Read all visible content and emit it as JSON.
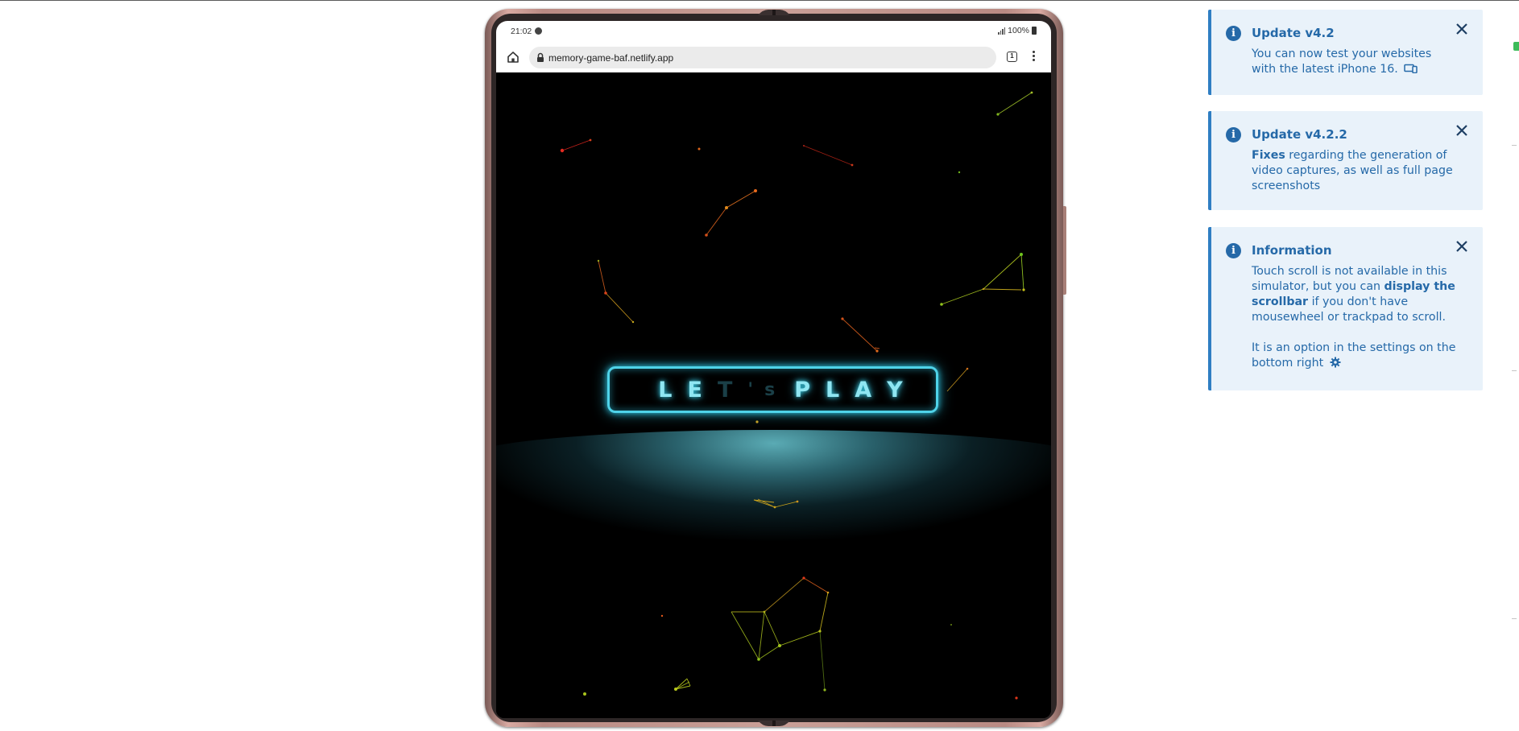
{
  "phone": {
    "status_time": "21:02",
    "battery": "100%",
    "url": "memory-game-baf.netlify.app",
    "tab_count": "1"
  },
  "game": {
    "play_letters": [
      "L",
      "E",
      "T",
      "'s",
      "P",
      "L",
      "A",
      "Y"
    ],
    "play_label": "LET's PLAY",
    "glow_color": "#4fd3e9"
  },
  "notifications": [
    {
      "title": "Update v4.2",
      "body_lines": [
        "You can now test your websites",
        "with the latest iPhone 16."
      ]
    },
    {
      "title": "Update v4.2.2",
      "body_bold": "Fixes",
      "body_rest": " regarding the generation of video captures, as well as full page screenshots"
    },
    {
      "title": "Information",
      "body_p1_a": "Touch scroll is not available in this simulator, but you can ",
      "body_p1_bold": "display the scrollbar",
      "body_p1_c": " if you don't have mousewheel or trackpad to scroll.",
      "body_p2": "It is an option in the settings on the bottom right"
    }
  ],
  "colors": {
    "accent": "#2f7ec3",
    "notif_bg": "#e9f2fa",
    "notif_text": "#2569a8"
  },
  "icons": [
    "home-icon",
    "lock-icon",
    "tabs-icon",
    "menu-icon",
    "info-icon",
    "close-icon",
    "devices-icon",
    "gear-icon"
  ]
}
